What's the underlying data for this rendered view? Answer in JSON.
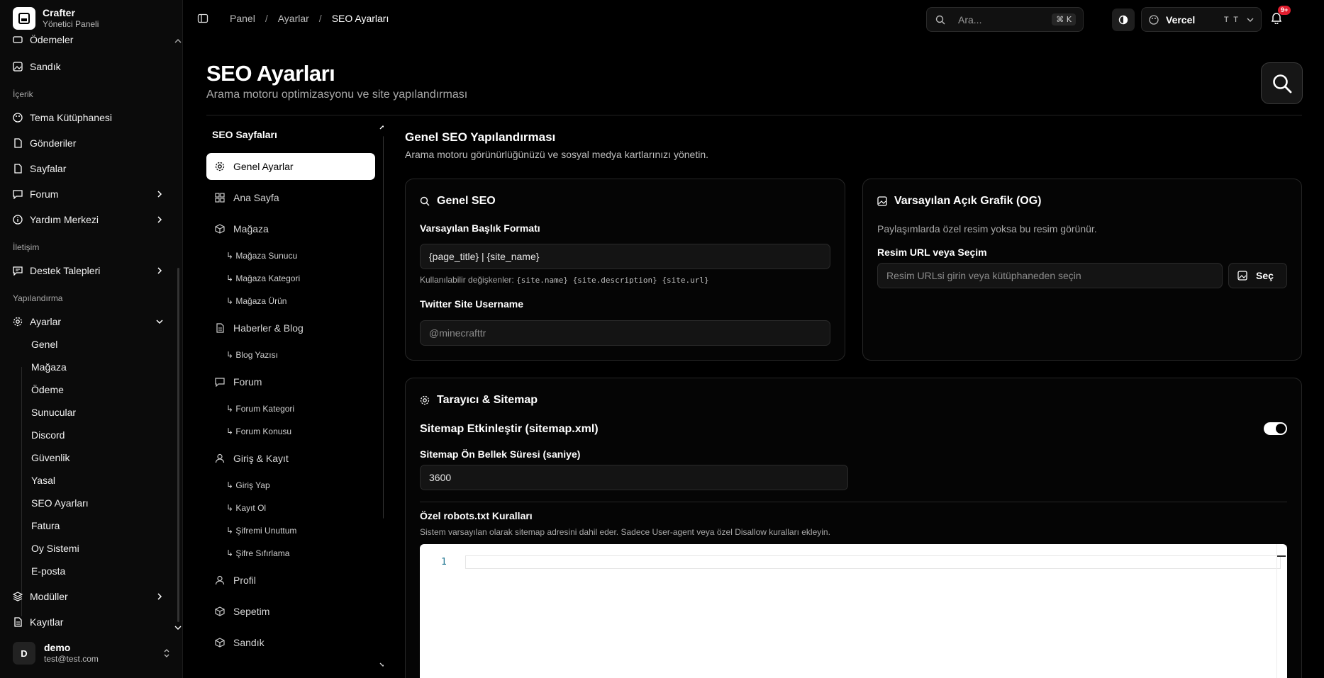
{
  "brand": {
    "title": "Crafter",
    "subtitle": "Yönetici Paneli"
  },
  "sidebar": {
    "partial_item": "Ödemeler",
    "sandik": "Sandık",
    "section_content": "İçerik",
    "tema": "Tema Kütüphanesi",
    "gonderiler": "Gönderiler",
    "sayfalar": "Sayfalar",
    "forum": "Forum",
    "yardim": "Yardım Merkezi",
    "section_contact": "İletişim",
    "destek": "Destek Talepleri",
    "section_config": "Yapılandırma",
    "ayarlar": "Ayarlar",
    "ayarlar_sub": [
      "Genel",
      "Mağaza",
      "Ödeme",
      "Sunucular",
      "Discord",
      "Güvenlik",
      "Yasal",
      "SEO Ayarları",
      "Fatura",
      "Oy Sistemi",
      "E-posta"
    ],
    "moduller": "Modüller",
    "kayitlar": "Kayıtlar"
  },
  "user": {
    "initial": "D",
    "name": "demo",
    "email": "test@test.com"
  },
  "topbar": {
    "breadcrumb": [
      "Panel",
      "Ayarlar",
      "SEO Ayarları"
    ],
    "search_placeholder": "Ara...",
    "search_shortcut": "⌘ K",
    "provider": "Vercel",
    "provider_initials": "T T",
    "notif_badge": "9+"
  },
  "page": {
    "title": "SEO Ayarları",
    "subtitle": "Arama motoru optimizasyonu ve site yapılandırması"
  },
  "seo_nav": {
    "heading": "SEO Sayfaları",
    "genel": "Genel Ayarlar",
    "ana": "Ana Sayfa",
    "magaza": "Mağaza",
    "magaza_sub": [
      "↳ Mağaza Sunucu",
      "↳ Mağaza Kategori",
      "↳ Mağaza Ürün"
    ],
    "haberler": "Haberler & Blog",
    "haberler_sub": [
      "↳ Blog Yazısı"
    ],
    "forum": "Forum",
    "forum_sub": [
      "↳ Forum Kategori",
      "↳ Forum Konusu"
    ],
    "giris": "Giriş & Kayıt",
    "giris_sub": [
      "↳ Giriş Yap",
      "↳ Kayıt Ol",
      "↳ Şifremi Unuttum",
      "↳ Şifre Sıfırlama"
    ],
    "profil": "Profil",
    "sepet": "Sepetim",
    "sandik": "Sandık"
  },
  "main": {
    "title": "Genel SEO Yapılandırması",
    "subtitle": "Arama motoru görünürlüğünüzü ve sosyal medya kartlarınızı yönetin.",
    "general_card": {
      "title": "Genel SEO",
      "title_format_label": "Varsayılan Başlık Formatı",
      "title_format_value": "{page_title} | {site_name}",
      "vars_prefix": "Kullanılabilir değişkenler:",
      "vars": "{site.name} {site.description} {site.url}",
      "twitter_label": "Twitter Site Username",
      "twitter_placeholder": "@minecrafttr"
    },
    "og_card": {
      "title": "Varsayılan Açık Grafik (OG)",
      "desc": "Paylaşımlarda özel resim yoksa bu resim görünür.",
      "image_label": "Resim URL veya Seçim",
      "image_placeholder": "Resim URLsi girin veya kütüphaneden seçin",
      "select_label": "Seç"
    },
    "crawler_card": {
      "title": "Tarayıcı & Sitemap",
      "sitemap_label": "Sitemap Etkinleştir (sitemap.xml)",
      "sitemap_enabled": true,
      "cache_label": "Sitemap Ön Bellek Süresi (saniye)",
      "cache_value": "3600",
      "robots_label": "Özel robots.txt Kuralları",
      "robots_hint": "Sistem varsayılan olarak sitemap adresini dahil eder. Sadece User-agent veya özel Disallow kuralları ekleyin.",
      "editor_line": "1"
    }
  },
  "colors": {
    "background": "#000000",
    "accent": "#ffffff",
    "badge": "#e11d2e"
  }
}
